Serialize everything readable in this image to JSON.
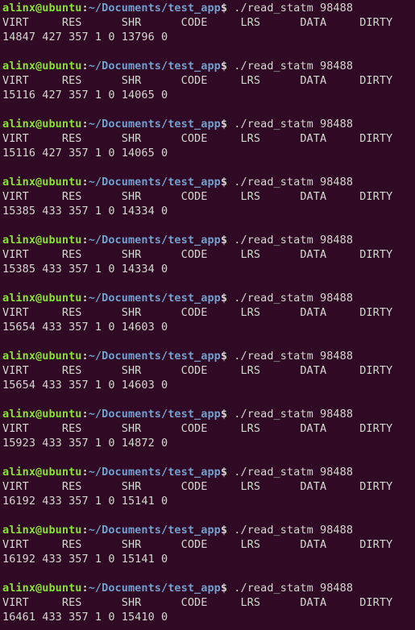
{
  "terminal": {
    "window_title": "alinx@ubuntu: ~/Documents/test_app",
    "colors": {
      "background": "#300a24",
      "foreground": "#d3d7cf",
      "prompt_user_host": "#8ae234",
      "prompt_path": "#729fcf"
    },
    "prompt": {
      "user_host": "alinx@ubuntu",
      "separator": ":",
      "path": "~/Documents/test_app",
      "dollar": "$",
      "command": " ./read_statm 98488"
    },
    "columns_header": "VIRT     RES      SHR      CODE     LRS      DATA     DIRTY",
    "column_names": [
      "VIRT",
      "RES",
      "SHR",
      "CODE",
      "LRS",
      "DATA",
      "DIRTY"
    ],
    "blocks": [
      {
        "header": "VIRT     RES      SHR      CODE     LRS      DATA     DIRTY",
        "values": "14847 427 357 1 0 13796 0",
        "fields": {
          "VIRT": 14847,
          "RES": 427,
          "SHR": 357,
          "CODE": 1,
          "LRS": 0,
          "DATA": 13796,
          "DIRTY": 0
        }
      },
      {
        "header": "VIRT     RES      SHR      CODE     LRS      DATA     DIRTY",
        "values": "15116 427 357 1 0 14065 0",
        "fields": {
          "VIRT": 15116,
          "RES": 427,
          "SHR": 357,
          "CODE": 1,
          "LRS": 0,
          "DATA": 14065,
          "DIRTY": 0
        }
      },
      {
        "header": "VIRT     RES      SHR      CODE     LRS      DATA     DIRTY",
        "values": "15116 427 357 1 0 14065 0",
        "fields": {
          "VIRT": 15116,
          "RES": 427,
          "SHR": 357,
          "CODE": 1,
          "LRS": 0,
          "DATA": 14065,
          "DIRTY": 0
        }
      },
      {
        "header": "VIRT     RES      SHR      CODE     LRS      DATA     DIRTY",
        "values": "15385 433 357 1 0 14334 0",
        "fields": {
          "VIRT": 15385,
          "RES": 433,
          "SHR": 357,
          "CODE": 1,
          "LRS": 0,
          "DATA": 14334,
          "DIRTY": 0
        }
      },
      {
        "header": "VIRT     RES      SHR      CODE     LRS      DATA     DIRTY",
        "values": "15385 433 357 1 0 14334 0",
        "fields": {
          "VIRT": 15385,
          "RES": 433,
          "SHR": 357,
          "CODE": 1,
          "LRS": 0,
          "DATA": 14334,
          "DIRTY": 0
        }
      },
      {
        "header": "VIRT     RES      SHR      CODE     LRS      DATA     DIRTY",
        "values": "15654 433 357 1 0 14603 0",
        "fields": {
          "VIRT": 15654,
          "RES": 433,
          "SHR": 357,
          "CODE": 1,
          "LRS": 0,
          "DATA": 14603,
          "DIRTY": 0
        }
      },
      {
        "header": "VIRT     RES      SHR      CODE     LRS      DATA     DIRTY",
        "values": "15654 433 357 1 0 14603 0",
        "fields": {
          "VIRT": 15654,
          "RES": 433,
          "SHR": 357,
          "CODE": 1,
          "LRS": 0,
          "DATA": 14603,
          "DIRTY": 0
        }
      },
      {
        "header": "VIRT     RES      SHR      CODE     LRS      DATA     DIRTY",
        "values": "15923 433 357 1 0 14872 0",
        "fields": {
          "VIRT": 15923,
          "RES": 433,
          "SHR": 357,
          "CODE": 1,
          "LRS": 0,
          "DATA": 14872,
          "DIRTY": 0
        }
      },
      {
        "header": "VIRT     RES      SHR      CODE     LRS      DATA     DIRTY",
        "values": "16192 433 357 1 0 15141 0",
        "fields": {
          "VIRT": 16192,
          "RES": 433,
          "SHR": 357,
          "CODE": 1,
          "LRS": 0,
          "DATA": 15141,
          "DIRTY": 0
        }
      },
      {
        "header": "VIRT     RES      SHR      CODE     LRS      DATA     DIRTY",
        "values": "16192 433 357 1 0 15141 0",
        "fields": {
          "VIRT": 16192,
          "RES": 433,
          "SHR": 357,
          "CODE": 1,
          "LRS": 0,
          "DATA": 15141,
          "DIRTY": 0
        }
      },
      {
        "header": "VIRT     RES      SHR      CODE     LRS      DATA     DIRTY",
        "values": "16461 433 357 1 0 15410 0",
        "fields": {
          "VIRT": 16461,
          "RES": 433,
          "SHR": 357,
          "CODE": 1,
          "LRS": 0,
          "DATA": 15410,
          "DIRTY": 0
        }
      }
    ]
  }
}
